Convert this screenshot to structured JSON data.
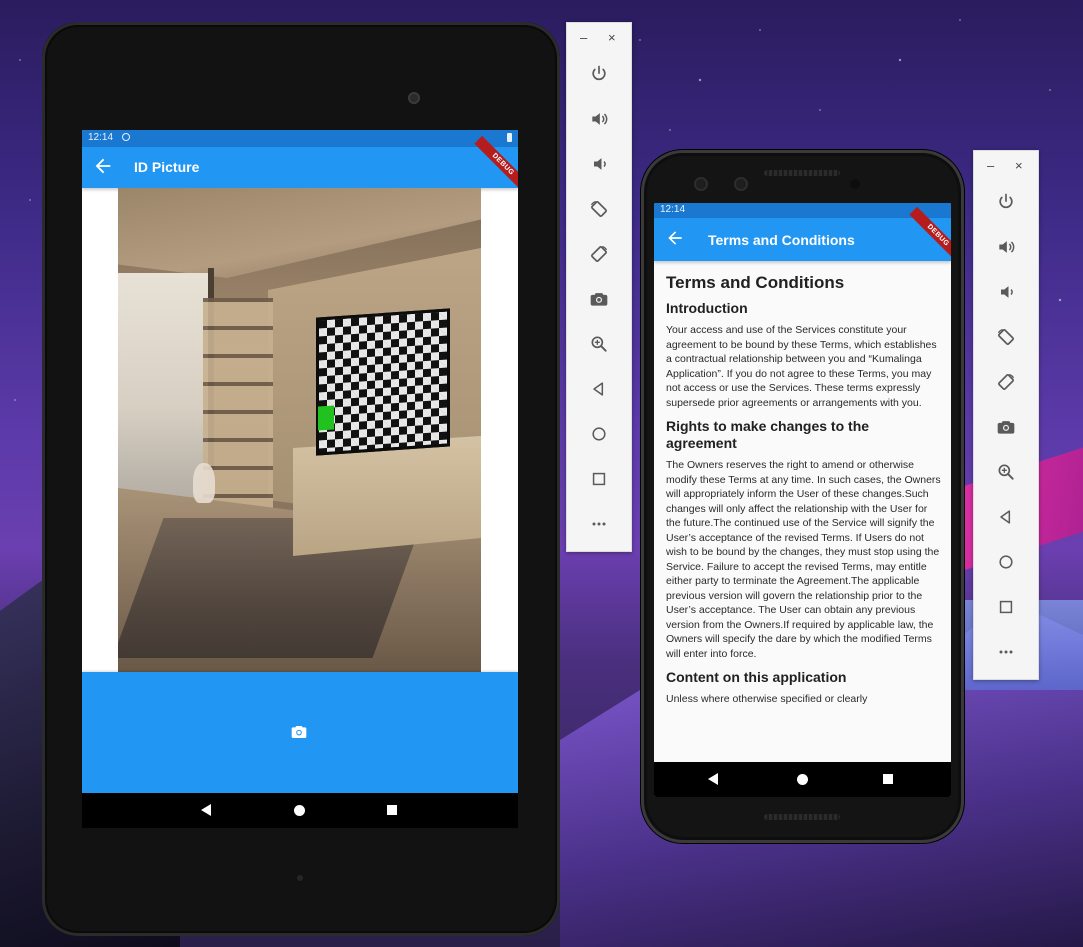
{
  "colors": {
    "appbar": "#2196f3",
    "statusbar": "#1a78d0",
    "debug_ribbon": "#b71c1c",
    "tv_green": "#21c21f"
  },
  "tablet": {
    "status_time": "12:14",
    "appbar_title": "ID Picture",
    "debug_label": "DEBUG",
    "back_icon": "arrow-back-icon",
    "capture_icon": "camera-icon"
  },
  "phone": {
    "status_time": "12:14",
    "appbar_title": "Terms and Conditions",
    "debug_label": "DEBUG",
    "content": {
      "heading": "Terms and Conditions",
      "sections": [
        {
          "title": "Introduction",
          "body": "Your access and use of the Services constitute your agreement to be bound by these Terms, which establishes a contractual relationship between you and “Kumalinga Application”. If you do not agree to these Terms, you may not access or use the Services. These terms expressly supersede prior agreements or arrangements with you."
        },
        {
          "title": "Rights to make changes to the agreement",
          "body": "The Owners reserves the right to amend or otherwise modify these Terms at any time. In such cases, the Owners will appropriately inform the User of these changes.Such changes will only affect the relationship with the User for the future.The continued use of the Service will signify the User’s acceptance of the revised Terms. If Users do not wish to be bound by the changes, they must stop using the Service. Failure to accept the revised Terms, may entitle either party to terminate the Agreement.The applicable previous version will govern the relationship prior to the User’s acceptance. The User can obtain any previous version from the Owners.If required by applicable law, the Owners will specify the dare by which the modified Terms will enter into force."
        },
        {
          "title": "Content on this application",
          "body": "Unless where otherwise specified or clearly"
        }
      ]
    }
  },
  "emulator_toolbar": {
    "minimize_label": "–",
    "close_label": "×",
    "buttons": [
      {
        "name": "power-icon"
      },
      {
        "name": "volume-up-icon"
      },
      {
        "name": "volume-down-icon"
      },
      {
        "name": "rotate-left-icon"
      },
      {
        "name": "rotate-right-icon"
      },
      {
        "name": "screenshot-camera-icon"
      },
      {
        "name": "zoom-icon"
      },
      {
        "name": "nav-back-icon"
      },
      {
        "name": "nav-home-icon"
      },
      {
        "name": "nav-overview-icon"
      },
      {
        "name": "more-options-icon"
      }
    ]
  }
}
